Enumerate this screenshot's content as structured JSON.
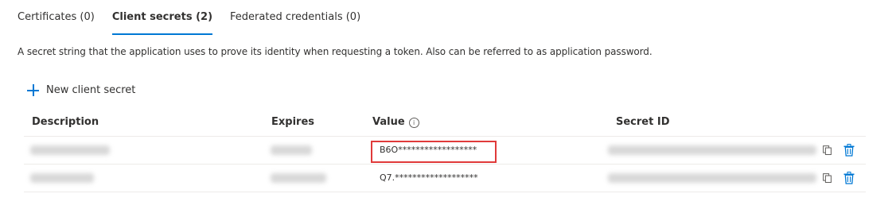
{
  "tabs": [
    {
      "label": "Certificates (0)",
      "active": false
    },
    {
      "label": "Client secrets (2)",
      "active": true
    },
    {
      "label": "Federated credentials (0)",
      "active": false
    }
  ],
  "description": "A secret string that the application uses to prove its identity when requesting a token. Also can be referred to as application password.",
  "toolbar": {
    "new_secret_label": "New client secret"
  },
  "table": {
    "columns": {
      "description": "Description",
      "expires": "Expires",
      "value": "Value",
      "secret_id": "Secret ID"
    },
    "rows": [
      {
        "value": "B6O******************",
        "highlighted": true
      },
      {
        "value": "Q7.*******************",
        "highlighted": false
      }
    ]
  },
  "colors": {
    "accent": "#0078d4",
    "highlight": "#e03a3a"
  }
}
